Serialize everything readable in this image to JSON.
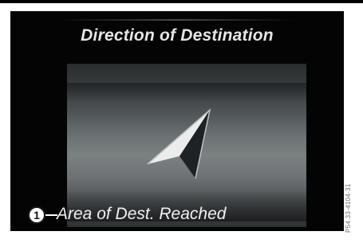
{
  "screen": {
    "title": "Direction of Destination",
    "status_text": "Area of Dest. Reached",
    "direction_icon": "navigation-arrow-icon"
  },
  "callout": {
    "number": "1"
  },
  "figure": {
    "side_code": "P54.33-4104-31"
  }
}
